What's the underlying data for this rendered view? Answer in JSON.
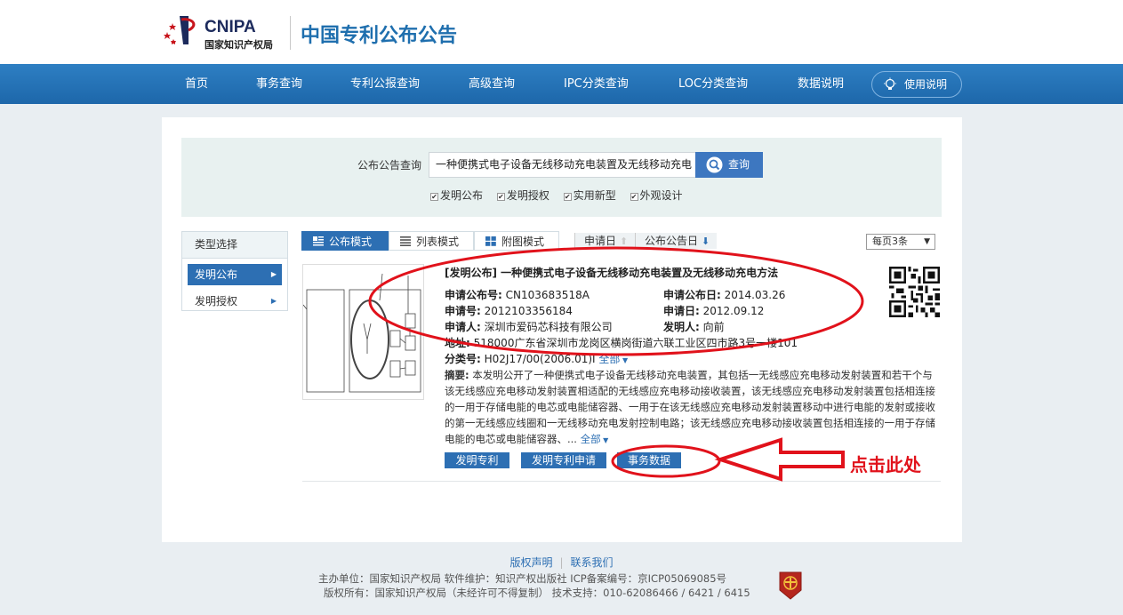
{
  "header": {
    "logo_cnipa": "CNIPA",
    "logo_org": "国家知识产权局",
    "site_title": "中国专利公布公告"
  },
  "nav": {
    "items": [
      "首页",
      "事务查询",
      "专利公报查询",
      "高级查询",
      "IPC分类查询",
      "LOC分类查询",
      "数据说明"
    ],
    "help": "使用说明"
  },
  "search": {
    "label": "公布公告查询",
    "value": "一种便携式电子设备无线移动充电装置及无线移动充电",
    "button": "查询",
    "checkboxes": [
      "发明公布",
      "发明授权",
      "实用新型",
      "外观设计"
    ]
  },
  "sidebar": {
    "title": "类型选择",
    "items": [
      "发明公布",
      "发明授权"
    ]
  },
  "toolbar": {
    "modes": [
      "公布模式",
      "列表模式",
      "附图模式"
    ],
    "sort": [
      "申请日",
      "公布公告日"
    ],
    "per_page": "每页3条"
  },
  "result": {
    "title": "[发明公布] 一种便携式电子设备无线移动充电装置及无线移动充电方法",
    "pub_no_label": "申请公布号:",
    "pub_no": "CN103683518A",
    "pub_date_label": "申请公布日:",
    "pub_date": "2014.03.26",
    "app_no_label": "申请号:",
    "app_no": "2012103356184",
    "app_date_label": "申请日:",
    "app_date": "2012.09.12",
    "applicant_label": "申请人:",
    "applicant": "深圳市爱码芯科技有限公司",
    "inventor_label": "发明人:",
    "inventor": "向前",
    "address_label": "地址:",
    "address": "518000广东省深圳市龙岗区横岗街道六联工业区四市路3号一楼101",
    "class_label": "分类号:",
    "class_no": "H02J17/00(2006.01)I",
    "more": "全部",
    "abstract_label": "摘要:",
    "abstract": "本发明公开了一种便携式电子设备无线移动充电装置，其包括一无线感应充电移动发射装置和若干个与该无线感应充电移动发射装置相适配的无线感应充电移动接收装置，该无线感应充电移动发射装置包括相连接的一用于存储电能的电芯或电能储容器、一用于在该无线感应充电移动发射装置移动中进行电能的发射或接收的第一无线感应线圈和一无线移动充电发射控制电路；该无线感应充电移动接收装置包括相连接的一用于存储电能的电芯或电能储容器、...",
    "buttons": [
      "发明专利",
      "发明专利申请",
      "事务数据"
    ]
  },
  "annotation": {
    "text": "点击此处"
  },
  "footer": {
    "links": [
      "版权声明",
      "联系我们"
    ],
    "line1": "主办单位：国家知识产权局    软件维护：知识产权出版社    ICP备案编号：京ICP05069085号",
    "line2": "版权所有：国家知识产权局（未经许可不得复制）    技术支持：010-62086466 / 6421 / 6415"
  },
  "colors": {
    "brand_blue": "#2d6fb3",
    "annotation_red": "#e1121b"
  }
}
